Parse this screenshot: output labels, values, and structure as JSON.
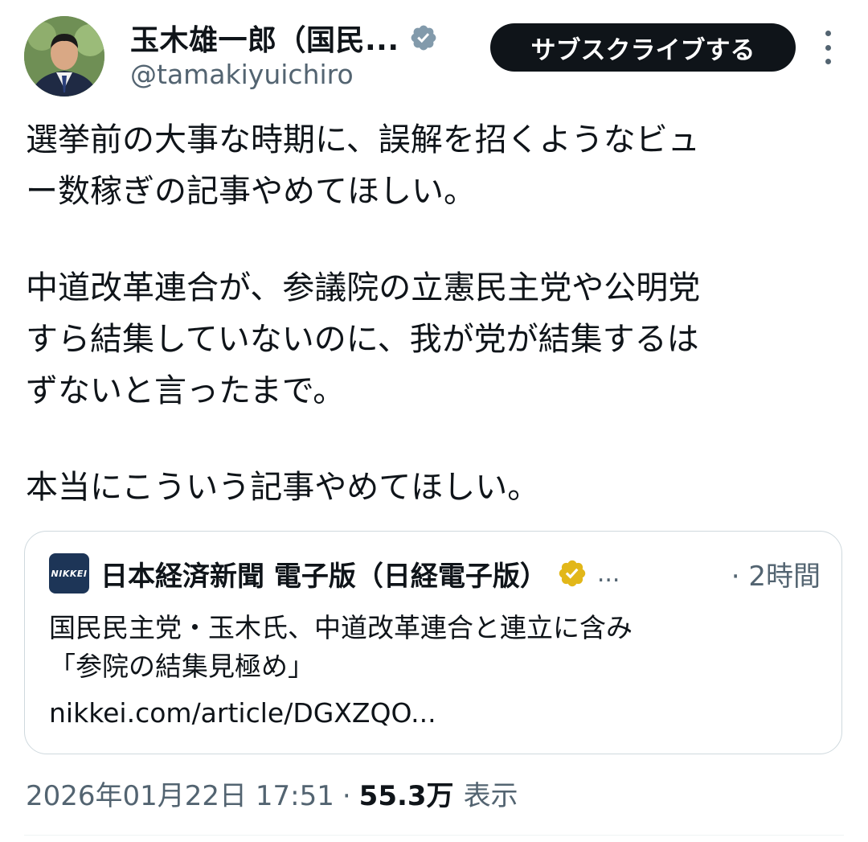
{
  "author": {
    "display_name": "玉木雄一郎（国民...",
    "handle": "@tamakiyuichiro"
  },
  "header": {
    "subscribe_label": "サブスクライブする"
  },
  "tweet": {
    "paragraph1": [
      "選挙前の大事な時期に、誤解を招くようなビュ",
      "ー数稼ぎの記事やめてほしい。"
    ],
    "paragraph2": [
      "中道改革連合が、参議院の立憲民主党や公明党",
      "すら結集していないのに、我が党が結集するは",
      "ずないと言ったまで。"
    ],
    "paragraph3": [
      "本当にこういう記事やめてほしい。"
    ]
  },
  "quote_card": {
    "logo_text": "NIKKEI",
    "source_name": "日本経済新聞 電子版（日経電子版）",
    "ellipsis": "...",
    "time": "· 2時間",
    "title_lines": [
      "国民民主党・玉木氏、中道改革連合と連立に含み",
      "「参院の結集見極め」"
    ],
    "url": "nikkei.com/article/DGXZQO..."
  },
  "meta": {
    "timestamp": "2026年01月22日 17:51",
    "separator": "·",
    "views_count": "55.3万",
    "views_label": "表示"
  },
  "colors": {
    "text": "#0f1419",
    "secondary": "#536471",
    "verified_gray": "#829aab",
    "verified_gold": "#e2b719",
    "button_bg": "#0f1419",
    "border": "#cfd9de"
  },
  "icons": {
    "verified": "verified-badge-icon",
    "gold_verified": "gold-verified-badge-icon",
    "more": "more-vertical-icon"
  }
}
